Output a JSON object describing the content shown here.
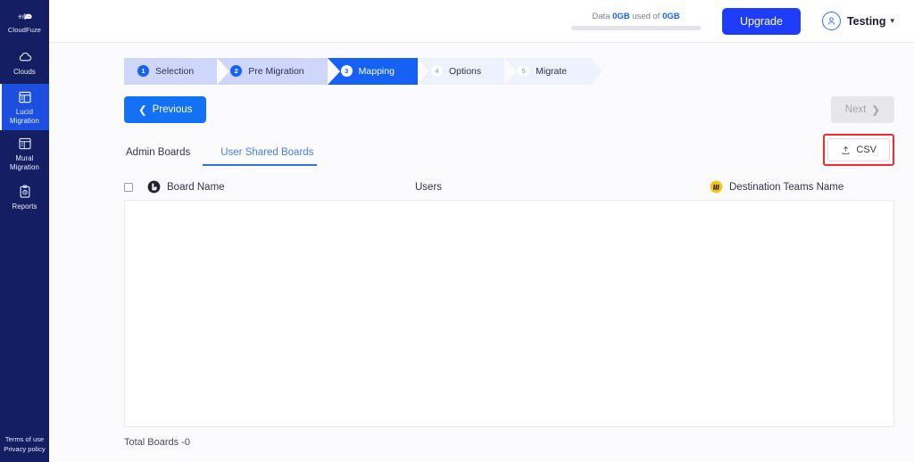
{
  "sidebar": {
    "brand": {
      "label": "CloudFuze",
      "icon": "cloudfuze-logo-icon"
    },
    "items": [
      {
        "label": "Clouds",
        "icon": "cloud-icon",
        "active": false
      },
      {
        "label": "Lucid\nMigration",
        "line1": "Lucid",
        "line2": "Migration",
        "icon": "board-layout-icon",
        "active": true
      },
      {
        "label": "Mural\nMigration",
        "line1": "Mural",
        "line2": "Migration",
        "icon": "board-layout-icon",
        "active": false
      },
      {
        "label": "Reports",
        "line1": "Reports",
        "line2": "",
        "icon": "clipboard-report-icon",
        "active": false
      }
    ],
    "footer": {
      "terms": "Terms of use",
      "privacy": "Privacy policy"
    }
  },
  "header": {
    "data_usage_prefix": "Data ",
    "data_usage_used": "0GB",
    "data_usage_mid": " used of ",
    "data_usage_total": "0GB",
    "data_usage_percent": 0,
    "upgrade_label": "Upgrade",
    "user_name": "Testing",
    "avatar_icon": "user-avatar-icon",
    "caret_icon": "chevron-down-icon"
  },
  "stepper": {
    "steps": [
      {
        "num": "1",
        "label": "Selection",
        "state": "done"
      },
      {
        "num": "2",
        "label": "Pre Migration",
        "state": "done"
      },
      {
        "num": "3",
        "label": "Mapping",
        "state": "active"
      },
      {
        "num": "4",
        "label": "Options",
        "state": "todo"
      },
      {
        "num": "5",
        "label": "Migrate",
        "state": "todo"
      }
    ]
  },
  "nav": {
    "previous_label": "Previous",
    "previous_icon": "chevron-left-icon",
    "next_label": "Next",
    "next_icon": "chevron-right-icon",
    "next_disabled": true
  },
  "tabs": [
    {
      "label": "Admin Boards",
      "active": false
    },
    {
      "label": "User Shared Boards",
      "active": true
    }
  ],
  "csv": {
    "label": "CSV",
    "icon": "upload-icon",
    "highlighted": true
  },
  "table": {
    "columns": [
      {
        "label": "Board Name",
        "icon": "lucid-icon"
      },
      {
        "label": "Users",
        "icon": ""
      },
      {
        "label": "Destination Teams Name",
        "icon": "mural-icon"
      }
    ],
    "select_all_checkbox": false,
    "rows": [],
    "total_label": "Total Boards -0"
  },
  "colors": {
    "sidebar_bg": "#131e63",
    "sidebar_active": "#1c4fe0",
    "accent_blue": "#1560f5",
    "upgrade_blue": "#1e3dfa",
    "step_done_bg": "#cfd6fb",
    "step_todo_bg": "#eef1fe",
    "highlight_red": "#ef2b2b",
    "mural_yellow": "#f5c518",
    "lucid_dark": "#23232e"
  }
}
